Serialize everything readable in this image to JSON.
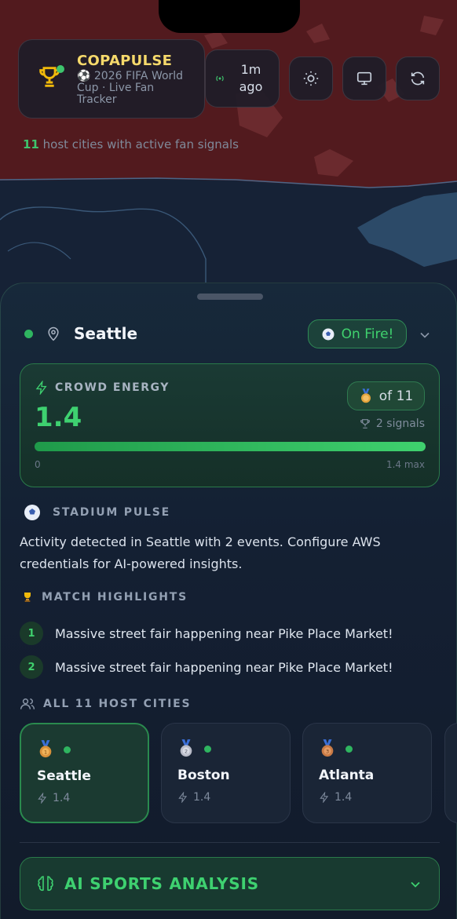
{
  "header": {
    "brand_name": "COPAPULSE",
    "brand_subtitle": "⚽ 2026 FIFA World Cup · Live Fan Tracker",
    "last_update": "1m ago",
    "active_cities_count": "11",
    "active_cities_text": " host cities with active fan signals",
    "buttons": [
      "sun-icon",
      "monitor-icon",
      "refresh-icon"
    ]
  },
  "location": {
    "city": "Seattle",
    "status_badge": "On Fire!"
  },
  "crowd_energy": {
    "label": "CROWD ENERGY",
    "value": "1.4",
    "rank": "of 11",
    "signals": "2 signals",
    "bar_min": "0",
    "bar_max": "1.4 max",
    "fill_fraction": 1.0
  },
  "stadium_pulse": {
    "label": "STADIUM PULSE",
    "text": "Activity detected in Seattle with 2 events. Configure AWS credentials for AI-powered insights."
  },
  "match_highlights": {
    "label": "MATCH HIGHLIGHTS",
    "items": [
      {
        "num": "1",
        "text": "Massive street fair happening near Pike Place Market!"
      },
      {
        "num": "2",
        "text": "Massive street fair happening near Pike Place Market!"
      }
    ]
  },
  "host_cities": {
    "label": "ALL 11 HOST CITIES",
    "cities": [
      {
        "name": "Seattle",
        "value": "1.4",
        "medal": "1",
        "medal_color": "#d9913a"
      },
      {
        "name": "Boston",
        "value": "1.4",
        "medal": "2",
        "medal_color": "#b9bcc8"
      },
      {
        "name": "Atlanta",
        "value": "1.4",
        "medal": "3",
        "medal_color": "#c97a45"
      }
    ]
  },
  "ai_analysis": {
    "label": "AI SPORTS ANALYSIS"
  },
  "colors": {
    "accent_green": "#3ed170",
    "brand_gold": "#f6d96b",
    "map_heat": "#5a1a1f"
  }
}
